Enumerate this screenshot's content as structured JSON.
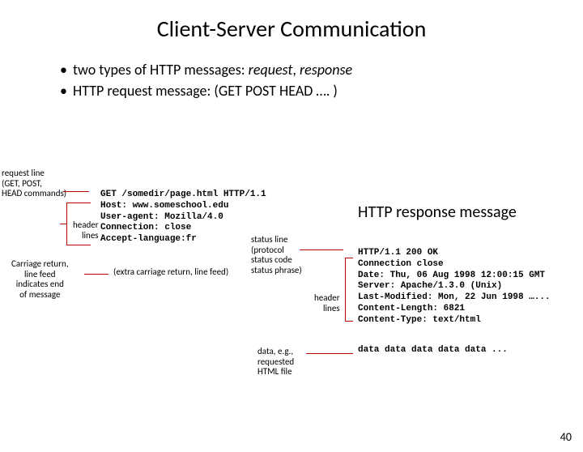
{
  "title": "Client-Server Communication",
  "bullets": {
    "b1_a": "two types of HTTP messages: ",
    "b1_b": "request",
    "b1_c": ", ",
    "b1_d": "response",
    "b2_a": "HTTP request message: (GET POST HEAD …. )"
  },
  "ann": {
    "request_line": "request line\n(GET, POST,\nHEAD commands)",
    "header_lines_left": "header\nlines",
    "carriage": "Carriage return,\nline feed\nindicates end\nof message",
    "extra_cr": "(extra carriage return, line feed)",
    "status": "status line\n(protocol\nstatus code\nstatus phrase)",
    "header_lines_right": "header\nlines",
    "data_ann": "data, e.g.,\nrequested\nHTML file"
  },
  "request_msg": "GET /somedir/page.html HTTP/1.1\nHost: www.someschool.edu\nUser-agent: Mozilla/4.0\nConnection: close\nAccept-language:fr",
  "response_title": "HTTP response message",
  "response_msg": "HTTP/1.1 200 OK\nConnection close\nDate: Thu, 06 Aug 1998 12:00:15 GMT\nServer: Apache/1.3.0 (Unix)\nLast-Modified: Mon, 22 Jun 1998 …...\nContent-Length: 6821\nContent-Type: text/html",
  "response_data": "data data data data data ...",
  "page_num": "40"
}
